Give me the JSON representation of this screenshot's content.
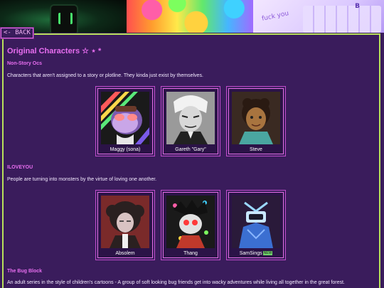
{
  "nav": {
    "back_label": "<- BACK"
  },
  "page": {
    "title": "Original Characters ☆ ⋆ *"
  },
  "sections": [
    {
      "title": "Non-Story Ocs",
      "description": "Characters that aren't assigned to a story or plotline. They kinda just exist by themselves.",
      "characters": [
        {
          "name": "Maggy (sona)"
        },
        {
          "name": "Gareth \"Gary\""
        },
        {
          "name": "Steve"
        }
      ]
    },
    {
      "title": "ILOVEYOU",
      "description": "People are turning into monsters by the virtue of loving one another.",
      "characters": [
        {
          "name": "Absolem"
        },
        {
          "name": "Thang"
        },
        {
          "name": "SamSings",
          "badge": "NEW"
        }
      ]
    },
    {
      "title": "The Bug Block",
      "description": "An adult series in the style of children's cartoons - A group of soft looking bug friends get into wacky adventures while living all together in the great forest."
    }
  ],
  "banner": {
    "note_text": "fuck you",
    "key_label": "B"
  },
  "colors": {
    "accent": "#e86ef0",
    "background": "#3a1c5c",
    "border": "#b8e05a"
  }
}
